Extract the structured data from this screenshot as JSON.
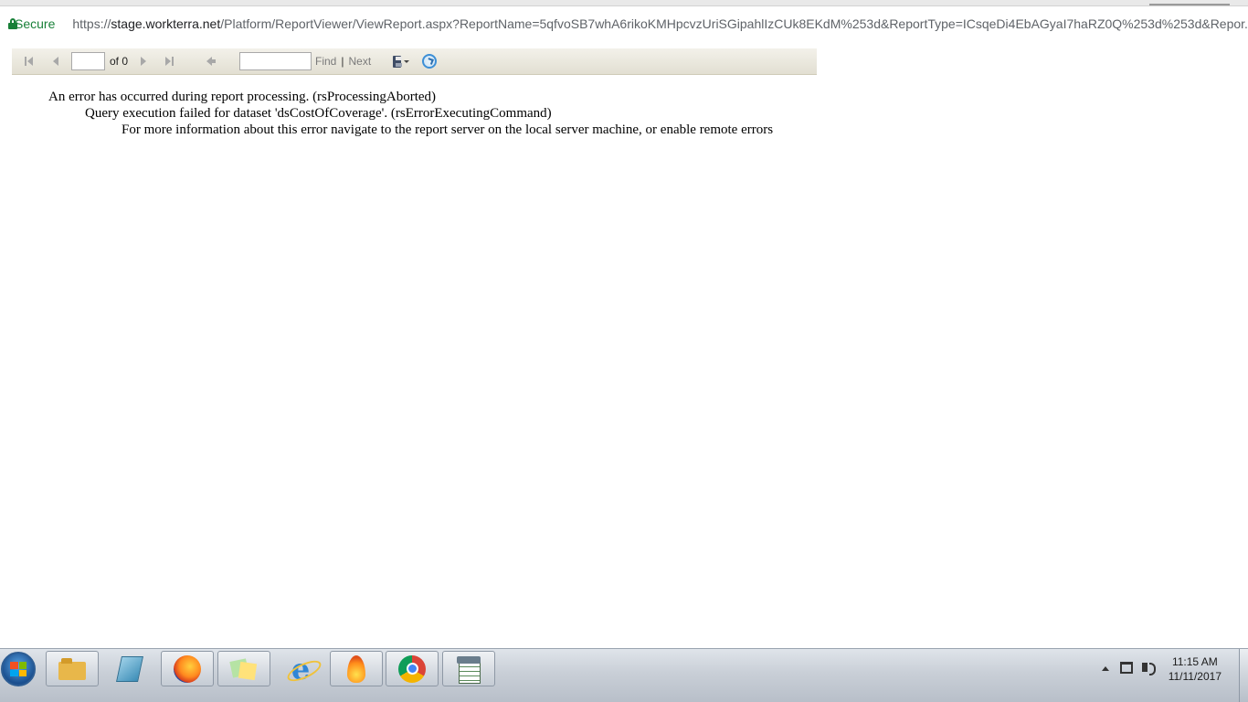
{
  "browser": {
    "secure_label": "Secure",
    "url_base": "https://",
    "url_domain": "stage.workterra.net",
    "url_path": "/Platform/ReportViewer/ViewReport.aspx?ReportName=5qfvoSB7whA6rikoKMHpcvzUriSGipahlIzCUk8EKdM%253d&ReportType=ICsqeDi4EbAGyaI7haRZ0Q%253d%253d&Repor..."
  },
  "toolbar": {
    "page_value": "",
    "of_label": "of 0",
    "find_value": "",
    "find_label": "Find",
    "separator": "|",
    "next_label": "Next"
  },
  "errors": {
    "line1": "An error has occurred during report processing. (rsProcessingAborted)",
    "line2": "Query execution failed for dataset 'dsCostOfCoverage'. (rsErrorExecutingCommand)",
    "line3": "For more information about this error navigate to the report server on the local server machine, or enable remote errors"
  },
  "taskbar": {
    "items": [
      {
        "icon": "windows-explorer-icon"
      },
      {
        "icon": "book-icon"
      },
      {
        "icon": "firefox-icon"
      },
      {
        "icon": "sticky-notes-icon"
      },
      {
        "icon": "internet-explorer-icon"
      },
      {
        "icon": "flame-app-icon"
      },
      {
        "icon": "chrome-icon"
      },
      {
        "icon": "spreadsheet-icon"
      }
    ],
    "clock_time": "11:15 AM",
    "clock_date": "11/11/2017"
  },
  "colors": {
    "secure_green": "#188038",
    "toolbar_bg": "#e8e5da",
    "taskbar_bg": "#c9cfd7"
  }
}
